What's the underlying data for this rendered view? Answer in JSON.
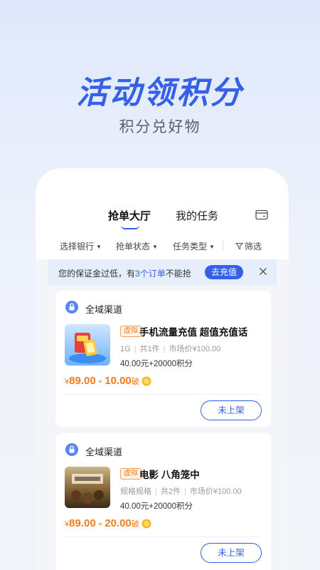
{
  "hero": {
    "title": "活动领积分",
    "subtitle": "积分兑好物"
  },
  "tabs": {
    "active": "抢单大厅",
    "mine": "我的任务"
  },
  "filters": [
    "选择银行",
    "抢单状态",
    "任务类型"
  ],
  "filter_button": "筛选",
  "notice": {
    "prefix": "您的保证金过低，有",
    "link": "3个订单",
    "suffix": "不能抢",
    "button": "去充值"
  },
  "cards": [
    {
      "channel": "全域渠道",
      "badge": "虚拟",
      "title": "手机流量充值 超值充值话",
      "spec": "1G",
      "count": "共1件",
      "market_price": "市场价¥100.00",
      "price_detail": "40.00元+20000积分",
      "price": {
        "currency": "¥",
        "amount": "89.00",
        "plus": "+",
        "points": "10.00",
        "unit": "破"
      },
      "button": "未上架"
    },
    {
      "channel": "全域渠道",
      "badge": "虚拟",
      "title": "电影 八角笼中",
      "spec": "规格规格",
      "count": "共2件",
      "market_price": "市场价¥100.00",
      "price_detail": "40.00元+20000积分",
      "price": {
        "currency": "¥",
        "amount": "89.00",
        "plus": "+",
        "points": "20.00",
        "unit": "破"
      },
      "button": "未上架"
    }
  ],
  "colors": {
    "accent": "#3560e8",
    "price": "#ef7d1a",
    "badge": "#ef7d1a"
  },
  "icons": {
    "wallet": "wallet-icon",
    "close": "close-icon",
    "lock": "lock-icon",
    "coin": "coin-icon",
    "filter": "filter-funnel-icon"
  }
}
